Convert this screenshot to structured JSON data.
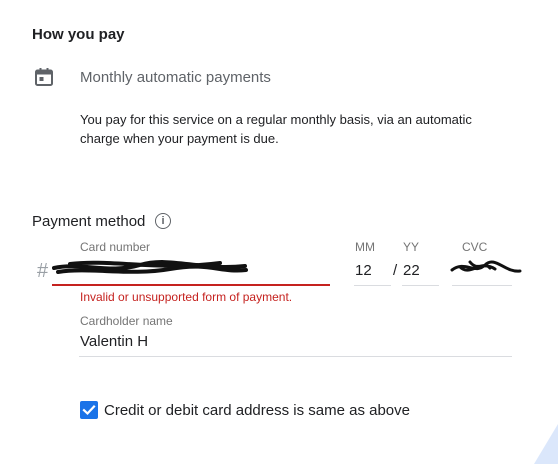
{
  "how_you_pay": {
    "title": "How you pay",
    "method": "Monthly automatic payments",
    "description": "You pay for this service on a regular monthly basis, via an automatic charge when your payment is due.",
    "icon": "calendar-icon"
  },
  "payment_method": {
    "title": "Payment method",
    "info_icon": "info-icon",
    "card_number": {
      "label": "Card number",
      "prefix": "#",
      "value": "",
      "error": "Invalid or unsupported form of payment."
    },
    "expiry": {
      "month_label": "MM",
      "month_value": "12",
      "separator": "/",
      "year_label": "YY",
      "year_value": "22"
    },
    "cvc": {
      "label": "CVC",
      "value": ""
    },
    "cardholder": {
      "label": "Cardholder name",
      "value": "Valentin H"
    },
    "address_checkbox": {
      "checked": true,
      "label": "Credit or debit card address is same as above"
    }
  },
  "colors": {
    "primary": "#1a73e8",
    "error": "#c5221f",
    "text": "#202124",
    "muted": "#757575"
  }
}
